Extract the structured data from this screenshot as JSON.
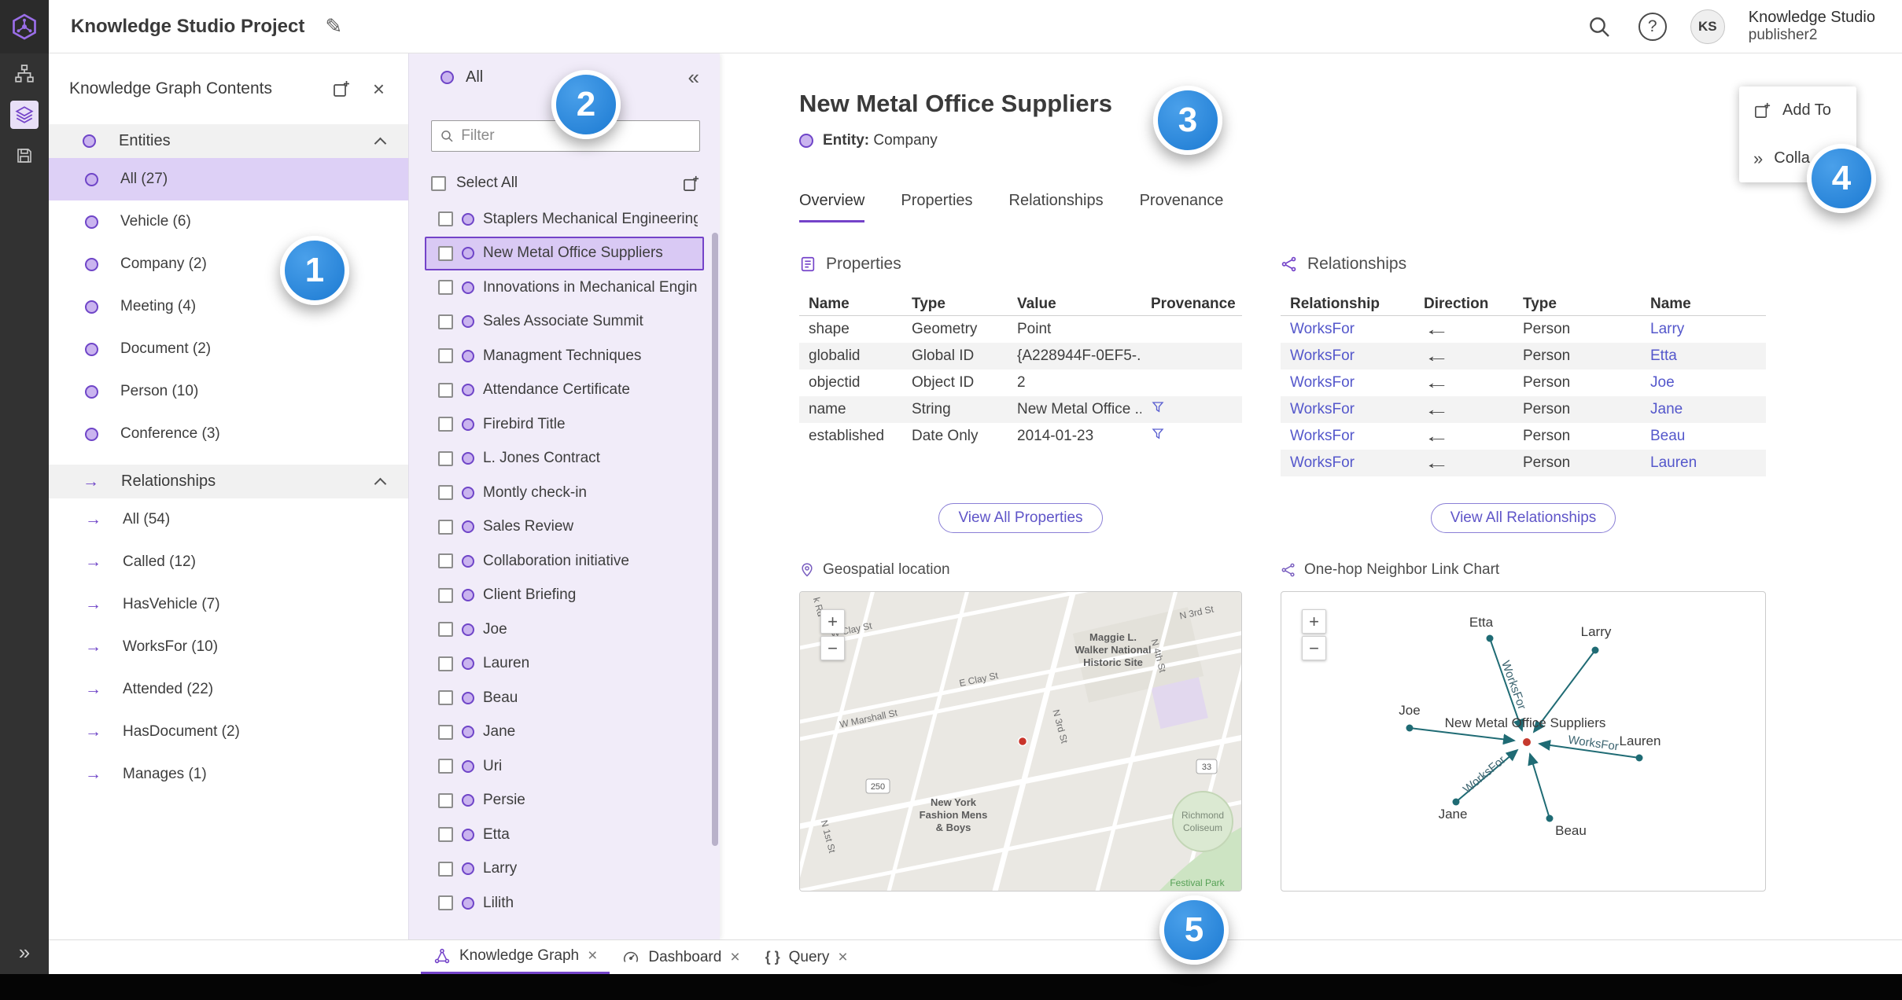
{
  "colors": {
    "accent_purple": "#7443c9",
    "selection_purple": "#ddd0f6",
    "panel2_background": "#f1ecf9",
    "link_blue": "#5457cb",
    "callout_blue": "#1c7ad2",
    "chart_teal": "#1f6b74",
    "marker_red": "#c9342a"
  },
  "icons": {
    "edit": "✎",
    "collapse_left": "«",
    "expand_right": "»",
    "close": "×",
    "help": "?",
    "plus": "+",
    "minus": "−",
    "braces": "{ }",
    "rel_arrow": "→"
  },
  "topbar": {
    "title": "Knowledge Studio Project",
    "user_name": "Knowledge Studio",
    "user_role": "publisher2",
    "avatar": "KS"
  },
  "contents_panel": {
    "title": "Knowledge Graph Contents",
    "entities": {
      "label": "Entities",
      "items": [
        "All (27)",
        "Vehicle (6)",
        "Company (2)",
        "Meeting (4)",
        "Document (2)",
        "Person (10)",
        "Conference (3)"
      ]
    },
    "relationships": {
      "label": "Relationships",
      "items": [
        "All (54)",
        "Called (12)",
        "HasVehicle (7)",
        "WorksFor (10)",
        "Attended (22)",
        "HasDocument (2)",
        "Manages (1)"
      ]
    }
  },
  "list_panel": {
    "header": "All",
    "filter_placeholder": "Filter",
    "select_all": "Select All",
    "items": [
      "Staplers Mechanical Engineering",
      "New Metal Office Suppliers",
      "Innovations in Mechanical Engin...",
      "Sales Associate Summit",
      "Managment Techniques",
      "Attendance Certificate",
      "Firebird Title",
      "L. Jones Contract",
      "Montly check-in",
      "Sales Review",
      "Collaboration initiative",
      "Client Briefing",
      "Joe",
      "Lauren",
      "Beau",
      "Jane",
      "Uri",
      "Persie",
      "Etta",
      "Larry",
      "Lilith"
    ]
  },
  "detail": {
    "title": "New Metal Office Suppliers",
    "entity_label": "Entity:",
    "entity_value": "Company",
    "tabs": [
      "Overview",
      "Properties",
      "Relationships",
      "Provenance"
    ],
    "properties": {
      "heading": "Properties",
      "columns": [
        "Name",
        "Type",
        "Value",
        "Provenance"
      ],
      "rows": [
        [
          "shape",
          "Geometry",
          "Point"
        ],
        [
          "globalid",
          "Global ID",
          "{A228944F-0EF5-..."
        ],
        [
          "objectid",
          "Object ID",
          "2"
        ],
        [
          "name",
          "String",
          "New Metal Office ..."
        ],
        [
          "established",
          "Date Only",
          "2014-01-23"
        ]
      ],
      "view_all": "View All Properties"
    },
    "relationships": {
      "heading": "Relationships",
      "columns": [
        "Relationship",
        "Direction",
        "Type",
        "Name"
      ],
      "rows": [
        [
          "WorksFor",
          "←",
          "Person",
          "Larry"
        ],
        [
          "WorksFor",
          "←",
          "Person",
          "Etta"
        ],
        [
          "WorksFor",
          "←",
          "Person",
          "Joe"
        ],
        [
          "WorksFor",
          "←",
          "Person",
          "Jane"
        ],
        [
          "WorksFor",
          "←",
          "Person",
          "Beau"
        ],
        [
          "WorksFor",
          "←",
          "Person",
          "Lauren"
        ]
      ],
      "view_all": "View All Relationships"
    },
    "geospatial": {
      "heading": "Geospatial location",
      "labels": [
        "W Clay St",
        "N 3rd St",
        "E Clay St",
        "N 3rd St",
        "N 4th St",
        "W Marshall St",
        "N 1st St",
        "Maggie L.",
        "Walker National",
        "Historic Site",
        "New York",
        "Fashion Mens",
        "& Boys",
        "Richmond",
        "Coliseum",
        "Festival Park",
        "250",
        "33",
        "k Rd"
      ]
    },
    "link_chart": {
      "heading": "One-hop Neighbor Link Chart",
      "center": "New Metal Office Suppliers",
      "edge_label": "WorksFor",
      "nodes": [
        "Etta",
        "Larry",
        "Joe",
        "Lauren",
        "Jane",
        "Beau"
      ]
    }
  },
  "overlay_menu": {
    "add_to": "Add To",
    "collapse": "Colla"
  },
  "bottom_tabs": [
    "Knowledge Graph",
    "Dashboard",
    "Query"
  ],
  "callouts": [
    "1",
    "2",
    "3",
    "4",
    "5"
  ]
}
